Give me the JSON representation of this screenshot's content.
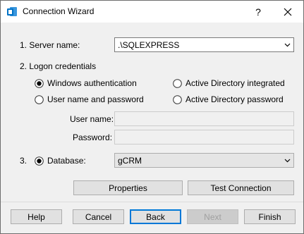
{
  "window": {
    "title": "Connection Wizard",
    "help_label": "?"
  },
  "server": {
    "label": "1. Server name:",
    "value": ".\\SQLEXPRESS"
  },
  "logon": {
    "label": "2. Logon credentials",
    "options": [
      {
        "label": "Windows authentication",
        "checked": true
      },
      {
        "label": "Active Directory integrated",
        "checked": false
      },
      {
        "label": "User name and password",
        "checked": false
      },
      {
        "label": "Active Directory password",
        "checked": false
      }
    ],
    "username_label": "User name:",
    "username_value": "",
    "password_label": "Password:",
    "password_value": ""
  },
  "database": {
    "number": "3.",
    "label": "Database:",
    "value": "gCRM",
    "checked": true
  },
  "actions": {
    "properties_label": "Properties",
    "test_label": "Test Connection"
  },
  "footer": {
    "help_label": "Help",
    "cancel_label": "Cancel",
    "back_label": "Back",
    "next_label": "Next",
    "finish_label": "Finish"
  },
  "colors": {
    "accent": "#0078d7",
    "app_icon": "#0072c6"
  },
  "icons": {
    "app": "connection-wizard-app-icon",
    "close": "close-icon",
    "dropdown": "chevron-down-icon"
  }
}
